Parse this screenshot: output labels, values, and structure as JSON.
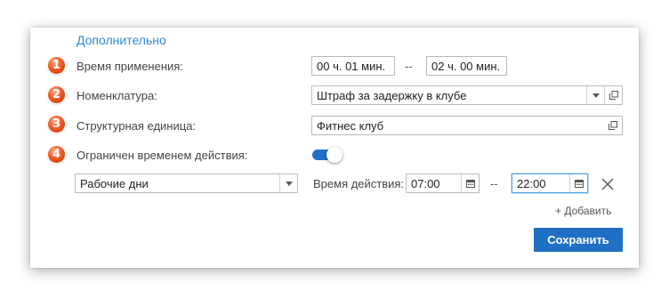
{
  "section_title": "Дополнительно",
  "rows": {
    "apply_time": {
      "number": "1",
      "label": "Время применения:",
      "from": "00 ч. 01 мин.",
      "separator": "--",
      "to": "02 ч. 00 мин."
    },
    "nomenclature": {
      "number": "2",
      "label": "Номенклатура:",
      "value": "Штраф за задержку в клубе"
    },
    "structural_unit": {
      "number": "3",
      "label": "Структурная единица:",
      "value": "Фитнес клуб"
    },
    "time_limited": {
      "number": "4",
      "label": "Ограничен временем действия:",
      "enabled": true
    }
  },
  "schedule": {
    "days_value": "Рабочие дни",
    "action_time_label": "Время действия:",
    "from_time": "07:00",
    "separator": "--",
    "to_time": "22:00"
  },
  "add_link": "+ Добавить",
  "save_button": "Сохранить",
  "icons": {
    "dropdown": "chevron-down-icon",
    "open": "open-window-icon",
    "calendar": "calendar-icon",
    "close": "close-icon"
  },
  "colors": {
    "accent": "#1f6fc5",
    "link": "#2f8ad0",
    "badge": "#f05a24",
    "focus_border": "#4fa4e3"
  }
}
